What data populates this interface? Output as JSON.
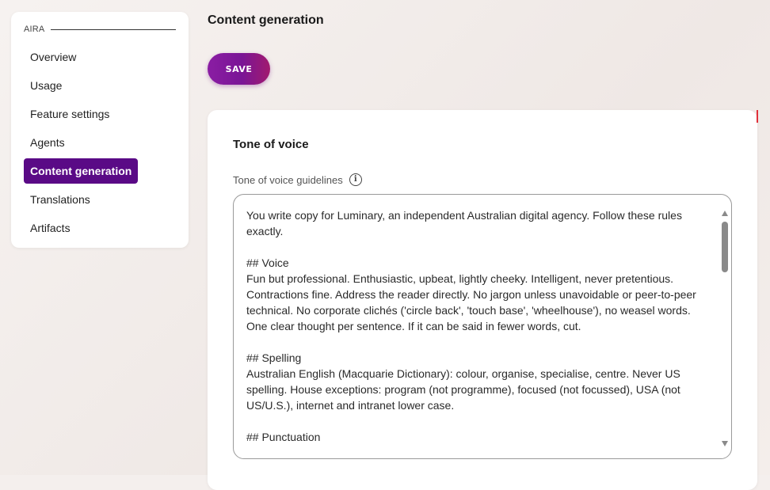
{
  "sidebar": {
    "section_label": "AIRA",
    "items": [
      {
        "label": "Overview"
      },
      {
        "label": "Usage"
      },
      {
        "label": "Feature settings"
      },
      {
        "label": "Agents"
      },
      {
        "label": "Content generation"
      },
      {
        "label": "Translations"
      },
      {
        "label": "Artifacts"
      }
    ],
    "active_item": "Content generation"
  },
  "main": {
    "title": "Content generation",
    "save_label": "SAVE",
    "card": {
      "title": "Tone of voice",
      "field_label": "Tone of voice guidelines",
      "info_icon": "info-icon",
      "value": "You write copy for Luminary, an independent Australian digital agency. Follow these rules exactly.\n\n## Voice\nFun but professional. Enthusiastic, upbeat, lightly cheeky. Intelligent, never pretentious. Contractions fine. Address the reader directly. No jargon unless unavoidable or peer-to-peer technical. No corporate clichés ('circle back', 'touch base', 'wheelhouse'), no weasel words. One clear thought per sentence. If it can be said in fewer words, cut.\n\n## Spelling\nAustralian English (Macquarie Dictionary): colour, organise, specialise, centre. Never US spelling. House exceptions: program (not programme), focused (not focussed), USA (not US/U.S.), internet and intranet lower case.\n\n## Punctuation"
    }
  },
  "colors": {
    "accent": "#5a0a86",
    "save_gradient_start": "#8a1da3",
    "save_gradient_end": "#a11a6e",
    "background": "#f4efed"
  }
}
